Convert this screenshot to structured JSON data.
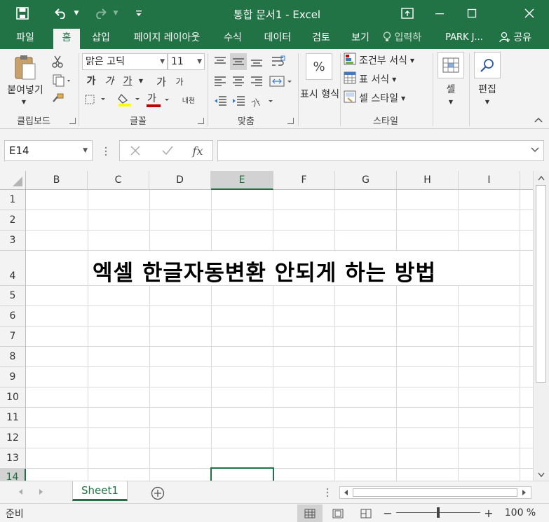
{
  "titlebar": {
    "title": "통합 문서1 - Excel",
    "save_icon": "save-icon",
    "undo_icon": "undo-icon",
    "redo_icon": "redo-icon"
  },
  "tabs": [
    {
      "label": "파일"
    },
    {
      "label": "홈"
    },
    {
      "label": "삽입"
    },
    {
      "label": "페이지 레이아웃"
    },
    {
      "label": "수식"
    },
    {
      "label": "데이터"
    },
    {
      "label": "검토"
    },
    {
      "label": "보기"
    }
  ],
  "tell_me": "입력하",
  "user": "PARK J...",
  "share": "공유",
  "ribbon": {
    "clipboard": {
      "paste": "붙여넣기",
      "label": "클립보드"
    },
    "font": {
      "name": "맑은 고딕",
      "size": "11",
      "bold": "가",
      "italic": "가",
      "underline": "가",
      "grow": "가",
      "shrink": "가",
      "font_color": "가",
      "phonetic": "내천",
      "label": "글꼴"
    },
    "alignment": {
      "label": "맞춤"
    },
    "number": {
      "format": "표시 형식",
      "pct": "%"
    },
    "styles": {
      "conditional": "조건부 서식",
      "table": "표 서식",
      "cell": "셀 스타일",
      "label": "스타일"
    },
    "cells": {
      "label": "셀"
    },
    "editing": {
      "label": "편집"
    }
  },
  "formula_bar": {
    "name_box": "E14",
    "fx": "fx",
    "value": ""
  },
  "sheet": {
    "columns": [
      "B",
      "C",
      "D",
      "E",
      "F",
      "G",
      "H",
      "I"
    ],
    "rows": [
      "1",
      "2",
      "3",
      "4",
      "5",
      "6",
      "7",
      "8",
      "9",
      "10",
      "11",
      "12",
      "13",
      "14"
    ],
    "selected_column": "E",
    "selected_row": "14",
    "headline": "엑셀 한글자동변환 안되게 하는 방법"
  },
  "sheet_tabs": [
    {
      "label": "Sheet1"
    }
  ],
  "status": {
    "ready": "준비",
    "zoom": "100 %"
  },
  "colors": {
    "accent": "#217346"
  }
}
